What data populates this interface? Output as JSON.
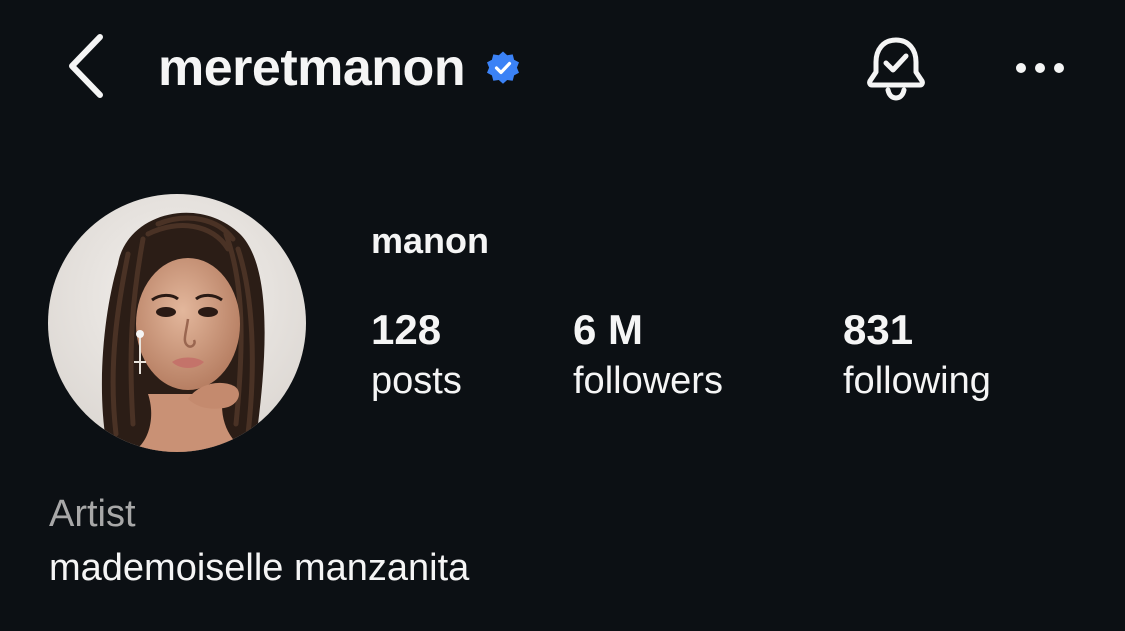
{
  "header": {
    "username": "meretmanon",
    "verified": true,
    "back_icon": "chevron-left-icon",
    "verified_icon": "verified-badge-icon",
    "bell_icon": "bell-check-icon",
    "more_icon": "more-horizontal-icon"
  },
  "profile": {
    "display_name": "manon",
    "avatar_alt": "profile photo",
    "stats": {
      "posts": {
        "value": "128",
        "label": "posts"
      },
      "followers": {
        "value": "6 M",
        "label": "followers"
      },
      "following": {
        "value": "831",
        "label": "following"
      }
    },
    "category": "Artist",
    "bio": "mademoiselle manzanita"
  },
  "colors": {
    "background": "#0c1014",
    "text": "#f5f5f5",
    "secondary_text": "#a8a8a8",
    "verified_blue": "#3b82f6"
  }
}
